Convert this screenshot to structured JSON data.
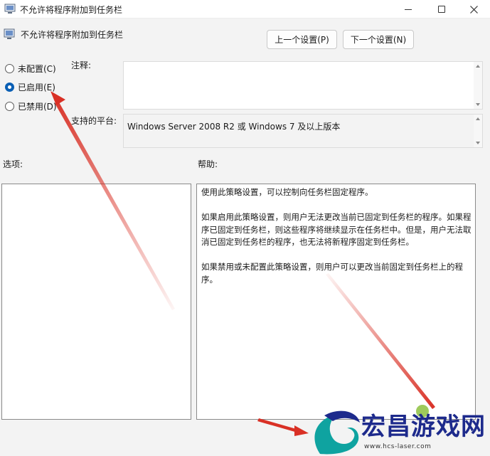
{
  "window": {
    "title": "不允许将程序附加到任务栏",
    "controls": {
      "minimize": "minimize-icon",
      "maximize": "maximize-icon",
      "close": "close-icon"
    }
  },
  "header": {
    "title": "不允许将程序附加到任务栏",
    "prev_label": "上一个设置(P)",
    "next_label": "下一个设置(N)"
  },
  "state": {
    "options": [
      {
        "label": "未配置(C)",
        "checked": false
      },
      {
        "label": "已启用(E)",
        "checked": true
      },
      {
        "label": "已禁用(D)",
        "checked": false
      }
    ]
  },
  "comment": {
    "label": "注释:",
    "value": ""
  },
  "platform": {
    "label": "支持的平台:",
    "value": "Windows Server 2008 R2 或 Windows 7 及以上版本"
  },
  "options_panel": {
    "label": "选项:"
  },
  "help_panel": {
    "label": "帮助:",
    "paragraphs": [
      "使用此策略设置，可以控制向任务栏固定程序。",
      "如果启用此策略设置，则用户无法更改当前已固定到任务栏的程序。如果程序已固定到任务栏，则这些程序将继续显示在任务栏中。但是，用户无法取消已固定到任务栏的程序，也无法将新程序固定到任务栏。",
      "如果禁用或未配置此策略设置，则用户可以更改当前固定到任务栏上的程序。"
    ]
  },
  "watermark": {
    "text": "宏昌游戏网",
    "url": "www.hcs-laser.com"
  },
  "colors": {
    "accent": "#0a5fb4",
    "annotation_arrow": "#d93025",
    "watermark": "#1d2a8c"
  }
}
